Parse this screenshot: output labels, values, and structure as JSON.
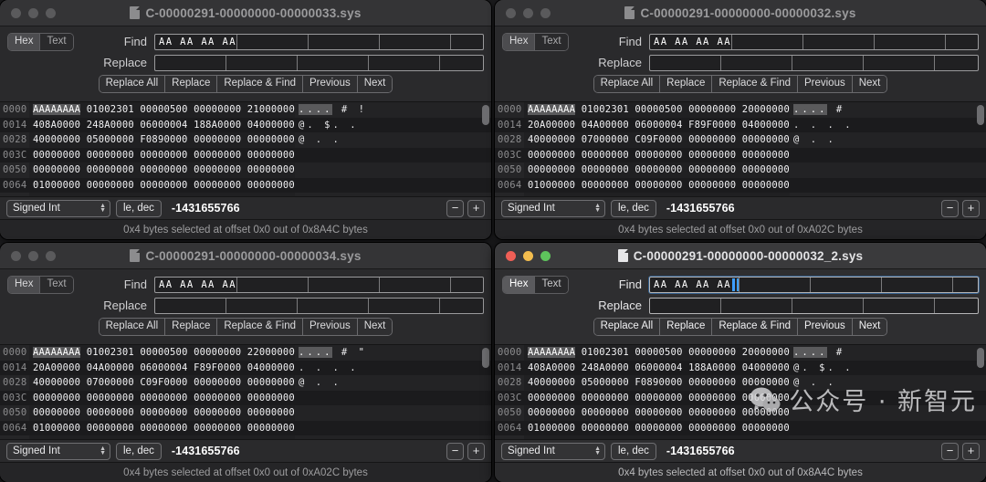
{
  "common": {
    "toggle": {
      "hex": "Hex",
      "text": "Text",
      "selected": "Hex"
    },
    "find_label": "Find",
    "replace_label": "Replace",
    "buttons": [
      "Replace All",
      "Replace",
      "Replace & Find",
      "Previous",
      "Next"
    ],
    "find_value": "AA AA AA AA",
    "replace_value": "",
    "inspector": {
      "type": "Signed Int",
      "endian": "le, dec",
      "value": "-1431655766",
      "minus": "−",
      "plus": "+"
    },
    "offsets": [
      "0000",
      "0014",
      "0028",
      "003C",
      "0050",
      "0064"
    ],
    "doc_icon": "document-icon",
    "traffic": [
      "close",
      "minimize",
      "maximize"
    ]
  },
  "accent": {
    "focus_blue": "#3e9dff",
    "close_red": "#ef5f56",
    "min_yellow": "#f3bd4e",
    "max_green": "#5ec45c"
  },
  "windows": [
    {
      "id": "win-33",
      "title": "C-00000291-00000000-00000033.sys",
      "active": false,
      "status": "0x4 bytes selected at offset 0x0 out of 0x8A4C bytes",
      "rows": [
        {
          "offset": "0000",
          "sel": "AAAAAAAA",
          "bytes": "01002301 00000500 00000000 21000000",
          "ascii_sel": "....",
          "ascii": "  #              !"
        },
        {
          "offset": "0014",
          "sel": "",
          "bytes": "408A0000 248A0000 06000004 188A0000 04000000",
          "ascii_sel": "",
          "ascii": "@.  $.          ."
        },
        {
          "offset": "0028",
          "sel": "",
          "bytes": "40000000 05000000 F0890000 00000000 00000000",
          "ascii_sel": "",
          "ascii": "@         . ."
        },
        {
          "offset": "003C",
          "sel": "",
          "bytes": "00000000 00000000 00000000 00000000 00000000",
          "ascii_sel": "",
          "ascii": ""
        },
        {
          "offset": "0050",
          "sel": "",
          "bytes": "00000000 00000000 00000000 00000000 00000000",
          "ascii_sel": "",
          "ascii": ""
        },
        {
          "offset": "0064",
          "sel": "",
          "bytes": "01000000 00000000 00000000 00000000 00000000",
          "ascii_sel": "",
          "ascii": ""
        }
      ]
    },
    {
      "id": "win-32",
      "title": "C-00000291-00000000-00000032.sys",
      "active": false,
      "status": "0x4 bytes selected at offset 0x0 out of 0xA02C bytes",
      "rows": [
        {
          "offset": "0000",
          "sel": "AAAAAAAA",
          "bytes": "01002301 00000500 00000000 20000000",
          "ascii_sel": "....",
          "ascii": "  #"
        },
        {
          "offset": "0014",
          "sel": "",
          "bytes": "20A00000 04A00000 06000004 F89F0000 04000000",
          "ascii_sel": "",
          "ascii": " .    .        . ."
        },
        {
          "offset": "0028",
          "sel": "",
          "bytes": "40000000 07000000 C09F0000 00000000 00000000",
          "ascii_sel": "",
          "ascii": "@         . ."
        },
        {
          "offset": "003C",
          "sel": "",
          "bytes": "00000000 00000000 00000000 00000000 00000000",
          "ascii_sel": "",
          "ascii": ""
        },
        {
          "offset": "0050",
          "sel": "",
          "bytes": "00000000 00000000 00000000 00000000 00000000",
          "ascii_sel": "",
          "ascii": ""
        },
        {
          "offset": "0064",
          "sel": "",
          "bytes": "01000000 00000000 00000000 00000000 00000000",
          "ascii_sel": "",
          "ascii": ""
        }
      ]
    },
    {
      "id": "win-34",
      "title": "C-00000291-00000000-00000034.sys",
      "active": false,
      "status": "0x4 bytes selected at offset 0x0 out of 0xA02C bytes",
      "rows": [
        {
          "offset": "0000",
          "sel": "AAAAAAAA",
          "bytes": "01002301 00000500 00000000 22000000",
          "ascii_sel": "....",
          "ascii": "  #              \""
        },
        {
          "offset": "0014",
          "sel": "",
          "bytes": "20A00000 04A00000 06000004 F89F0000 04000000",
          "ascii_sel": "",
          "ascii": " .    .        . ."
        },
        {
          "offset": "0028",
          "sel": "",
          "bytes": "40000000 07000000 C09F0000 00000000 00000000",
          "ascii_sel": "",
          "ascii": "@         . ."
        },
        {
          "offset": "003C",
          "sel": "",
          "bytes": "00000000 00000000 00000000 00000000 00000000",
          "ascii_sel": "",
          "ascii": ""
        },
        {
          "offset": "0050",
          "sel": "",
          "bytes": "00000000 00000000 00000000 00000000 00000000",
          "ascii_sel": "",
          "ascii": ""
        },
        {
          "offset": "0064",
          "sel": "",
          "bytes": "01000000 00000000 00000000 00000000 00000000",
          "ascii_sel": "",
          "ascii": ""
        }
      ]
    },
    {
      "id": "win-32-2",
      "title": "C-00000291-00000000-00000032_2.sys",
      "active": true,
      "status": "0x4 bytes selected at offset 0x0 out of 0x8A4C bytes",
      "rows": [
        {
          "offset": "0000",
          "sel": "AAAAAAAA",
          "bytes": "01002301 00000500 00000000 20000000",
          "ascii_sel": "....",
          "ascii": "  #"
        },
        {
          "offset": "0014",
          "sel": "",
          "bytes": "408A0000 248A0000 06000004 188A0000 04000000",
          "ascii_sel": "",
          "ascii": "@.  $.          ."
        },
        {
          "offset": "0028",
          "sel": "",
          "bytes": "40000000 05000000 F0890000 00000000 00000000",
          "ascii_sel": "",
          "ascii": "@         . ."
        },
        {
          "offset": "003C",
          "sel": "",
          "bytes": "00000000 00000000 00000000 00000000 00000000",
          "ascii_sel": "",
          "ascii": ""
        },
        {
          "offset": "0050",
          "sel": "",
          "bytes": "00000000 00000000 00000000 00000000 00000000",
          "ascii_sel": "",
          "ascii": ""
        },
        {
          "offset": "0064",
          "sel": "",
          "bytes": "01000000 00000000 00000000 00000000 00000000",
          "ascii_sel": "",
          "ascii": ""
        }
      ]
    }
  ],
  "watermark": {
    "text": "公众号 · 新智元",
    "logo": "wechat-logo"
  }
}
